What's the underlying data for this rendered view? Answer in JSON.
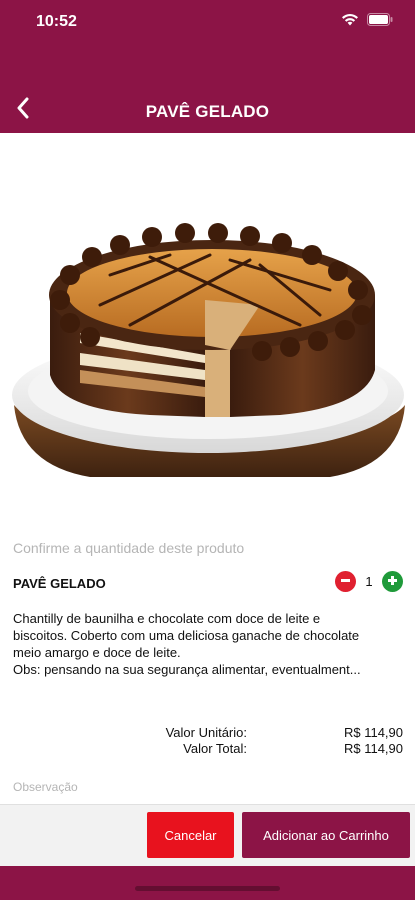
{
  "status_bar": {
    "time": "10:52",
    "icons": [
      "wifi-icon",
      "battery-icon"
    ]
  },
  "header": {
    "title": "PAVÊ GELADO",
    "back_icon": "chevron-left-icon"
  },
  "product": {
    "image": "cake-photo",
    "confirm_prompt": "Confirme a quantidade deste produto",
    "name": "PAVÊ GELADO",
    "quantity": "1",
    "description_lines": [
      "Chantilly de baunilha e chocolate com doce de leite e",
      "biscoitos. Coberto com uma deliciosa ganache de chocolate",
      "meio amargo e doce de leite.",
      "Obs: pensando na sua segurança alimentar, eventualment..."
    ]
  },
  "pricing": {
    "unit_label": "Valor Unitário:",
    "unit_value": "R$ 114,90",
    "total_label": "Valor Total:",
    "total_value": "R$ 114,90"
  },
  "observation": {
    "placeholder": "Observação"
  },
  "actions": {
    "cancel_label": "Cancelar",
    "add_label": "Adicionar ao Carrinho"
  },
  "colors": {
    "brand": "#8c1446",
    "cancel": "#e8121e",
    "minus": "#e02030",
    "plus": "#1f9a3a"
  }
}
